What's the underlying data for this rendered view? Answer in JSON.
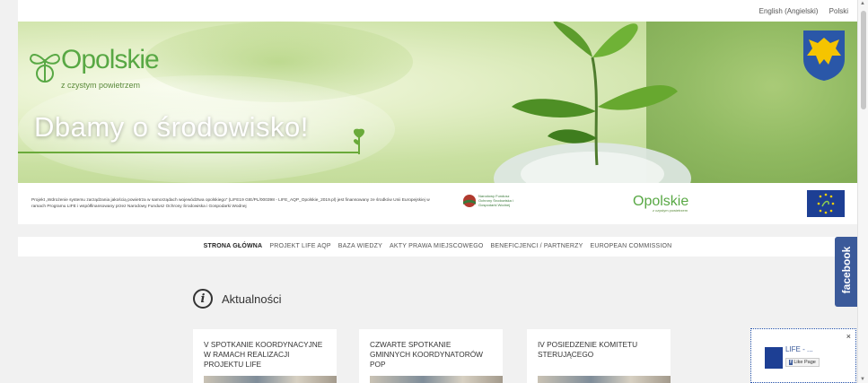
{
  "lang": {
    "english": "English (Angielski)",
    "polish": "Polski"
  },
  "hero": {
    "brand": "Opolskie",
    "tagline": "z czystym powietrzem",
    "slogan": "Dbamy o środowisko!"
  },
  "funding": {
    "text": "Projekt „Wdrożenie systemu zarządzania jakością powietrza w samorządach województwa opolskiego” (LIFE19 GIE/PL/000398 - LIFE_AQP_Opolskie_2019.pl) jest finansowany ze środków Unii Europejskiej w ramach Programu LIFE i współfinansowany przez Narodowy Fundusz Ochrony Środowiska i Gospodarki Wodnej",
    "nfos_label": "Narodowy Fundusz Ochrony Środowiska i Gospodarki Wodnej",
    "partner_brand": "Opolskie",
    "partner_tag": "z czystym powietrzem"
  },
  "nav": {
    "items": [
      "STRONA GŁÓWNA",
      "PROJEKT LIFE AQP",
      "BAZA WIEDZY",
      "AKTY PRAWA MIEJSCOWEGO",
      "BENEFICJENCI / PARTNERZY",
      "EUROPEAN COMMISSION"
    ]
  },
  "news": {
    "heading": "Aktualności",
    "cards": [
      {
        "title": "V SPOTKANIE KOORDYNACYJNE W RAMACH REALIZACJI PROJEKTU LIFE"
      },
      {
        "title": "CZWARTE SPOTKANIE GMINNYCH KOORDYNATORÓW POP"
      },
      {
        "title": "IV POSIEDZENIE KOMITETU STERUJĄCEGO"
      }
    ]
  },
  "facebook": {
    "tab_label": "facebook",
    "page_name": "LIFE - ...",
    "like_label": "Like Page",
    "close_label": "×"
  },
  "colors": {
    "brand_green": "#58a844",
    "facebook_blue": "#3b5a9a",
    "eu_blue": "#1d3f94"
  }
}
